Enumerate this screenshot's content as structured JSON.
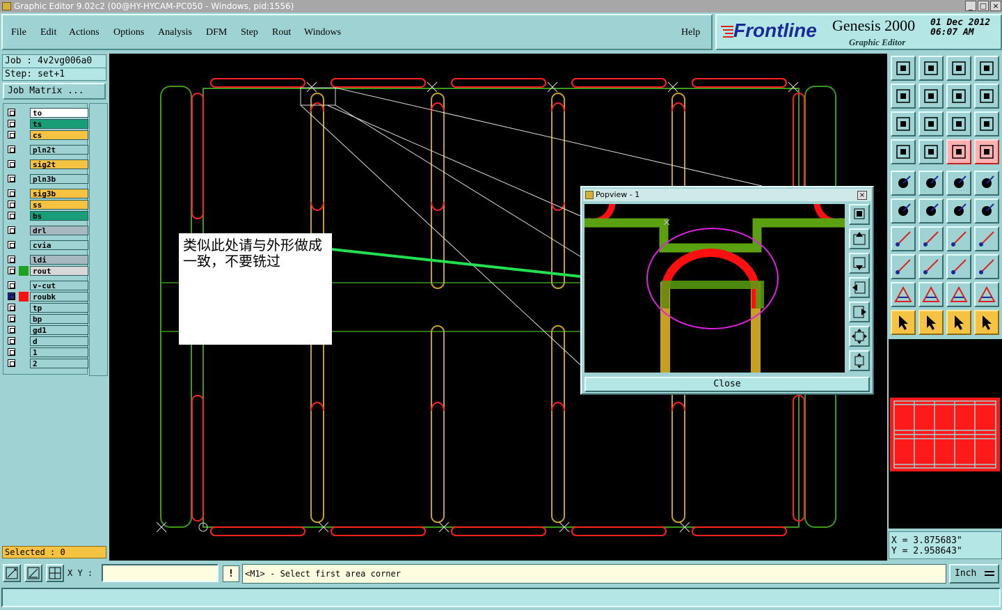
{
  "window": {
    "title": "Graphic Editor 9.02c2 (00@HY-HYCAM-PC050 - Windows, pid:1556)",
    "buttons": [
      "_",
      "□",
      "×"
    ]
  },
  "menu": {
    "items": [
      "File",
      "Edit",
      "Actions",
      "Options",
      "Analysis",
      "DFM",
      "Step",
      "Rout",
      "Windows"
    ],
    "help": "Help"
  },
  "logo": {
    "brand": "Frontline",
    "product": "Genesis 2000",
    "subtitle": "Graphic Editor",
    "date": "01 Dec 2012",
    "time": "06:07 AM"
  },
  "job": {
    "job_line": "Job : 4v2vg006a0",
    "step_line": "Step: set+1",
    "matrix_button": "Job Matrix ..."
  },
  "layers": [
    {
      "name": "to",
      "color": "#ffffff",
      "indicator": ""
    },
    {
      "name": "ts",
      "color": "#1a9e7a",
      "indicator": ""
    },
    {
      "name": "cs",
      "color": "#f5c242",
      "indicator": ""
    },
    {
      "name": "pln2t",
      "color": "#9fd3d3",
      "indicator": ""
    },
    {
      "name": "sig2t",
      "color": "#f5c242",
      "indicator": ""
    },
    {
      "name": "pln3b",
      "color": "#9fd3d3",
      "indicator": ""
    },
    {
      "name": "sig3b",
      "color": "#f5c242",
      "indicator": ""
    },
    {
      "name": "ss",
      "color": "#f5c242",
      "indicator": ""
    },
    {
      "name": "bs",
      "color": "#1a9e7a",
      "indicator": ""
    },
    {
      "name": "drl",
      "color": "#a8b8c0",
      "indicator": ""
    },
    {
      "name": "cvia",
      "color": "#9fd3d3",
      "indicator": ""
    },
    {
      "name": "ldi",
      "color": "#a8b8c0",
      "indicator": ""
    },
    {
      "name": "rout",
      "color": "#d8d8d8",
      "indicator": "#1fa01f"
    },
    {
      "name": "v-cut",
      "color": "#9fd3d3",
      "indicator": ""
    },
    {
      "name": "roubk",
      "color": "#9fd3d3",
      "indicator": "#ff1010"
    },
    {
      "name": "tp",
      "color": "#9fd3d3",
      "indicator": ""
    },
    {
      "name": "bp",
      "color": "#9fd3d3",
      "indicator": ""
    },
    {
      "name": "gd1",
      "color": "#9fd3d3",
      "indicator": ""
    },
    {
      "name": "d",
      "color": "#9fd3d3",
      "indicator": ""
    },
    {
      "name": "1",
      "color": "#9fd3d3",
      "indicator": ""
    },
    {
      "name": "2",
      "color": "#9fd3d3",
      "indicator": ""
    }
  ],
  "selected": "Selected : 0",
  "popview": {
    "title": "Popview - 1",
    "close_label": "Close"
  },
  "annotation": {
    "text": "类似此处请与外形做成一致，不要铣过"
  },
  "coords": {
    "x": "X = 3.875683\"",
    "y": "Y = 2.958643\""
  },
  "bottom": {
    "xy_label": "X Y :",
    "xy_value": "",
    "bang": "!",
    "prompt": "<M1> - Select first area corner",
    "unit": "Inch"
  },
  "colors": {
    "background": "#9fd3d3",
    "canvas": "#000000",
    "outline_green": "#3a9a1a",
    "rout_orange": "#c8a020",
    "slot_red": "#ff2020",
    "highlight_yellow": "#f5c242"
  }
}
